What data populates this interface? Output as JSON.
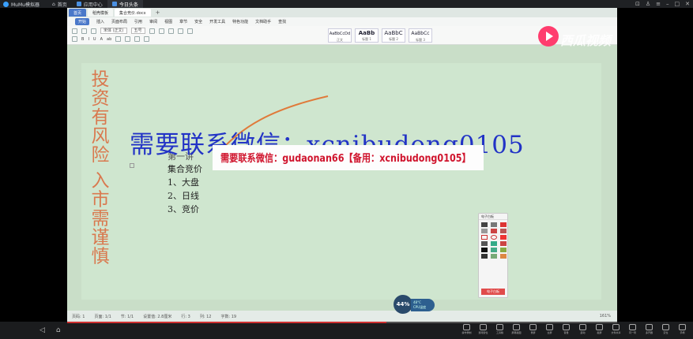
{
  "emulator": {
    "title": "MuMu模拟器",
    "tabs": [
      {
        "label": "首页"
      },
      {
        "label": "应用中心"
      },
      {
        "label": "今日头条"
      }
    ]
  },
  "wps": {
    "tabs": [
      "首页",
      "稻壳模板",
      "集合竞价.docx"
    ],
    "menu": [
      "开始",
      "插入",
      "页面布局",
      "引用",
      "审阅",
      "视图",
      "章节",
      "安全",
      "开发工具",
      "特色功能",
      "文档助手",
      "查找"
    ],
    "font_name": "宋体 (正文)",
    "font_size": "五号",
    "styles": [
      {
        "preview": "AaBbCcDd",
        "name": "正文"
      },
      {
        "preview": "AaBb",
        "name": "标题 1"
      },
      {
        "preview": "AaBbC",
        "name": "标题 2"
      },
      {
        "preview": "AaBbCc",
        "name": "标题 3"
      }
    ],
    "watermark": "西瓜视频"
  },
  "document": {
    "vertical_stamp": "投资有风险 入市需谨慎",
    "contact_big": "需要联系微信：xcnibudong0105",
    "contact_banner": "需要联系微信：gudaonan66【备用：xcnibudong0105】",
    "lines": [
      "第一讲",
      "集合竞价",
      "1、大盘",
      "2、日线",
      "3、竞价"
    ]
  },
  "pen_panel": {
    "title": "电子白板",
    "footer": "电子白板"
  },
  "status": {
    "page": "页码: 1",
    "pages": "页面: 1/1",
    "section": "节: 1/1",
    "position": "设置值: 2.8厘米",
    "line": "行: 3",
    "col": "列: 12",
    "words": "字数: 19",
    "zoom": "161%"
  },
  "cpu": {
    "value": "44%",
    "temp": "48°C",
    "label": "CPU温度"
  },
  "progress": 0.58,
  "bottom_tools": [
    "操作录制",
    "游戏键位",
    "工具箱",
    "屏幕截图",
    "录屏",
    "全屏",
    "音量",
    "震动",
    "截屏",
    "文件共享",
    "同一局",
    "多开器",
    "定位",
    "手柄"
  ]
}
